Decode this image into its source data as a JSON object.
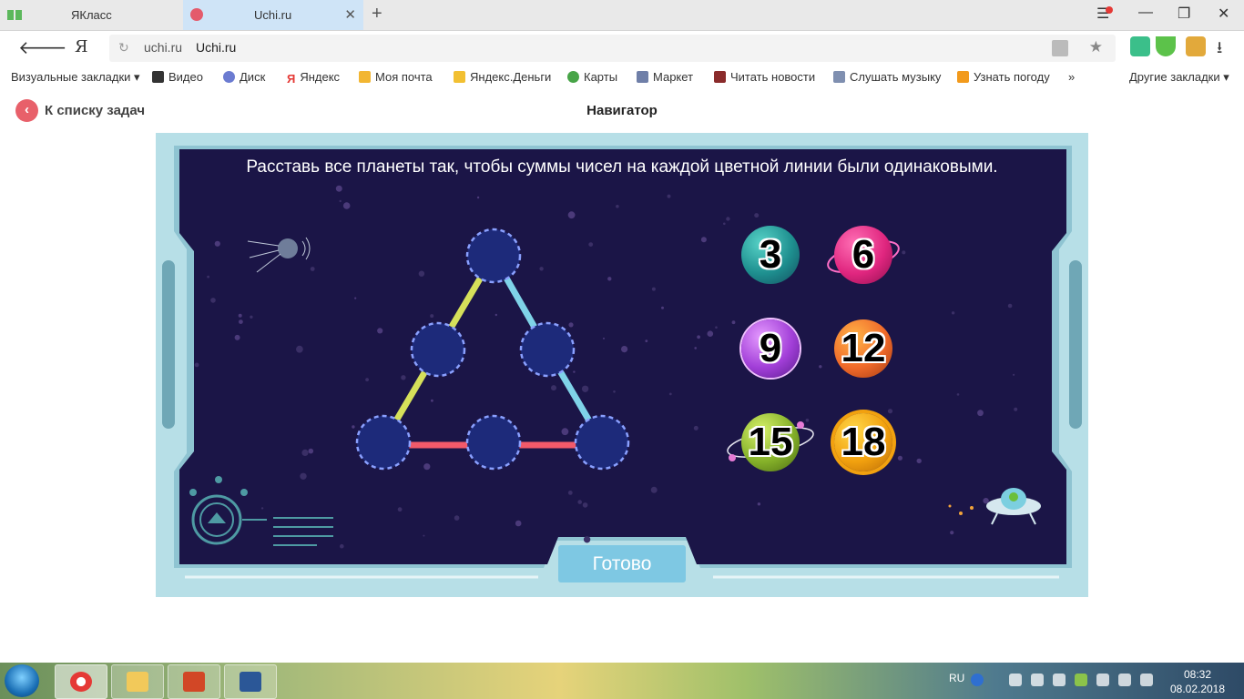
{
  "browser": {
    "tabs": [
      {
        "label": "ЯКласс",
        "active": false
      },
      {
        "label": "Uchi.ru",
        "active": true
      }
    ],
    "address": {
      "domain": "uchi.ru",
      "title": "Uchi.ru"
    },
    "bookmarks": [
      {
        "label": "Визуальные закладки ▾",
        "icon": "none"
      },
      {
        "label": "Видео",
        "icon": "video-icon"
      },
      {
        "label": "Диск",
        "icon": "disk-icon"
      },
      {
        "label": "Яндекс",
        "icon": "yandex-icon"
      },
      {
        "label": "Моя почта",
        "icon": "mail-icon"
      },
      {
        "label": "Яндекс.Деньги",
        "icon": "money-icon"
      },
      {
        "label": "Карты",
        "icon": "maps-icon"
      },
      {
        "label": "Маркет",
        "icon": "market-icon"
      },
      {
        "label": "Читать новости",
        "icon": "news-icon"
      },
      {
        "label": "Слушать музыку",
        "icon": "music-icon"
      },
      {
        "label": "Узнать погоду",
        "icon": "weather-icon"
      }
    ],
    "bookmarks_overflow": "»",
    "other_bookmarks": "Другие закладки ▾"
  },
  "page": {
    "back_label": "К списку задач",
    "title": "Навигатор"
  },
  "game": {
    "instruction": "Расставь все планеты так, чтобы суммы чисел на каждой цветной линии были одинаковыми.",
    "planets": [
      "3",
      "6",
      "9",
      "12",
      "15",
      "18"
    ],
    "done_label": "Готово",
    "colors": {
      "panel": "#1b1547",
      "frame": "#b7dfe7",
      "slot": "#1d2a7a",
      "slot_border": "#8aa0ff",
      "line_left": "#d6e05a",
      "line_right": "#7fd3e8",
      "line_bottom": "#f25a6a"
    }
  },
  "taskbar": {
    "lang": "RU",
    "time": "08:32",
    "date": "08.02.2018"
  }
}
